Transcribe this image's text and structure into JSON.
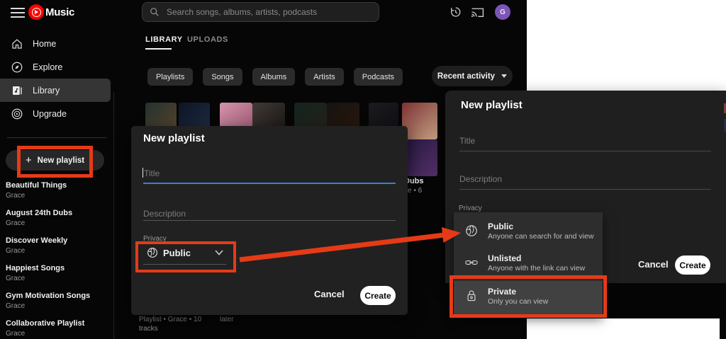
{
  "app": {
    "brand": "Music"
  },
  "topbar": {
    "search_placeholder": "Search songs, albums, artists, podcasts",
    "avatar_initial": "G"
  },
  "tabs": {
    "library": "LIBRARY",
    "uploads": "UPLOADS"
  },
  "chips": [
    "Playlists",
    "Songs",
    "Albums",
    "Artists",
    "Podcasts"
  ],
  "sort": {
    "label": "Recent activity"
  },
  "sidebar": {
    "nav": [
      {
        "label": "Home"
      },
      {
        "label": "Explore"
      },
      {
        "label": "Library"
      },
      {
        "label": "Upgrade"
      }
    ],
    "new_playlist_label": "New playlist",
    "new_playlist_plus": "+",
    "playlists": [
      {
        "title": "Beautiful Things",
        "subtitle": "Grace"
      },
      {
        "title": "August 24th Dubs",
        "subtitle": "Grace"
      },
      {
        "title": "Discover Weekly",
        "subtitle": "Grace"
      },
      {
        "title": "Happiest Songs",
        "subtitle": "Grace"
      },
      {
        "title": "Gym Motivation Songs",
        "subtitle": "Grace"
      },
      {
        "title": "Collaborative Playlist",
        "subtitle": "Grace"
      }
    ]
  },
  "grid": {
    "cut_item_title": "Dubs",
    "cut_item_subtitle": "ce • 6",
    "bottom_left_line1": "Playlist • Grace • 10",
    "bottom_left_line2": "tracks",
    "bottom_mid": "later"
  },
  "dialog": {
    "heading": "New playlist",
    "title_placeholder": "Title",
    "description_placeholder": "Description",
    "privacy_label": "Privacy",
    "privacy_value": "Public",
    "cancel": "Cancel",
    "create": "Create"
  },
  "privacy_menu": {
    "options": [
      {
        "name": "Public",
        "desc": "Anyone can search for and view"
      },
      {
        "name": "Unlisted",
        "desc": "Anyone with the link can view"
      },
      {
        "name": "Private",
        "desc": "Only you can view"
      }
    ]
  },
  "colors": {
    "annotation_red": "#e63a17",
    "focus_blue": "#3b7dd8",
    "brand_red": "#ff0000",
    "avatar_purple": "#7d55b5"
  },
  "thumbnails": [
    {
      "from": "#233230",
      "to": "#67492a"
    },
    {
      "from": "#0d1524",
      "to": "#24324e"
    },
    {
      "from": "#d493ac",
      "to": "#8e4a63"
    },
    {
      "from": "#403a35",
      "to": "#120d0b"
    },
    {
      "from": "#13241f",
      "to": "#2c2019"
    },
    {
      "from": "#151310",
      "to": "#30190d"
    },
    {
      "from": "#1a1a1f",
      "to": "#0d0d10"
    },
    {
      "from": "#7d3032",
      "to": "#c2a183"
    },
    {
      "from": "#241741",
      "to": "#553067"
    }
  ]
}
